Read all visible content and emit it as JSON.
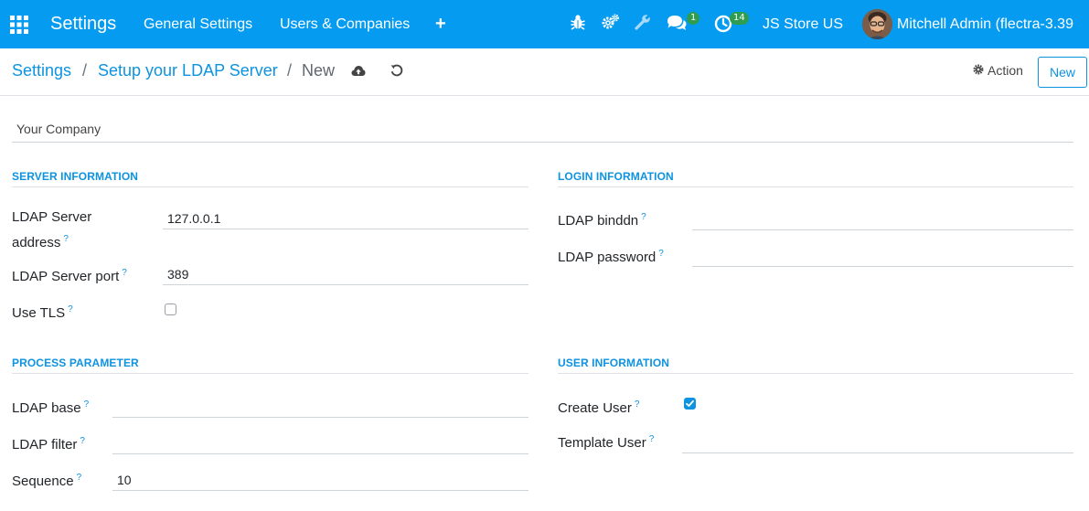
{
  "navbar": {
    "app_title": "Settings",
    "menu_general": "General Settings",
    "menu_users": "Users & Companies",
    "menu_plus": "+",
    "icons": [
      "apps-icon",
      "bug-icon",
      "gears-icon",
      "wrench-icon",
      "chat-icon",
      "clock-icon"
    ],
    "messages_count": "1",
    "activities_count": "14",
    "company_name": "JS Store US",
    "user_name": "Mitchell Admin (flectra-3.39",
    "colors": {
      "bar": "#049bf0",
      "badge": "#2e9d50"
    }
  },
  "breadcrumb": {
    "root": "Settings",
    "sep1": "/",
    "parent": "Setup your LDAP Server",
    "sep2": "/",
    "current": "New"
  },
  "toolbar": {
    "action_label": "Action",
    "new_label": "New"
  },
  "form": {
    "company": "Your Company",
    "help_mark": "?",
    "server_info": {
      "title": "SERVER INFORMATION",
      "address_label_1": "LDAP Server",
      "address_label_2": "address",
      "address_value": "127.0.0.1",
      "port_label": "LDAP Server port",
      "port_value": "389",
      "tls_label": "Use TLS",
      "tls_checked": false
    },
    "login_info": {
      "title": "LOGIN INFORMATION",
      "binddn_label": "LDAP binddn",
      "binddn_value": "",
      "password_label": "LDAP password",
      "password_value": ""
    },
    "process_param": {
      "title": "PROCESS PARAMETER",
      "base_label": "LDAP base",
      "base_value": "",
      "filter_label": "LDAP filter",
      "filter_value": "",
      "sequence_label": "Sequence",
      "sequence_value": "10"
    },
    "user_info": {
      "title": "USER INFORMATION",
      "create_user_label": "Create User",
      "create_user_checked": true,
      "template_user_label": "Template User",
      "template_user_value": ""
    },
    "accent_color": "#0d93e0"
  }
}
